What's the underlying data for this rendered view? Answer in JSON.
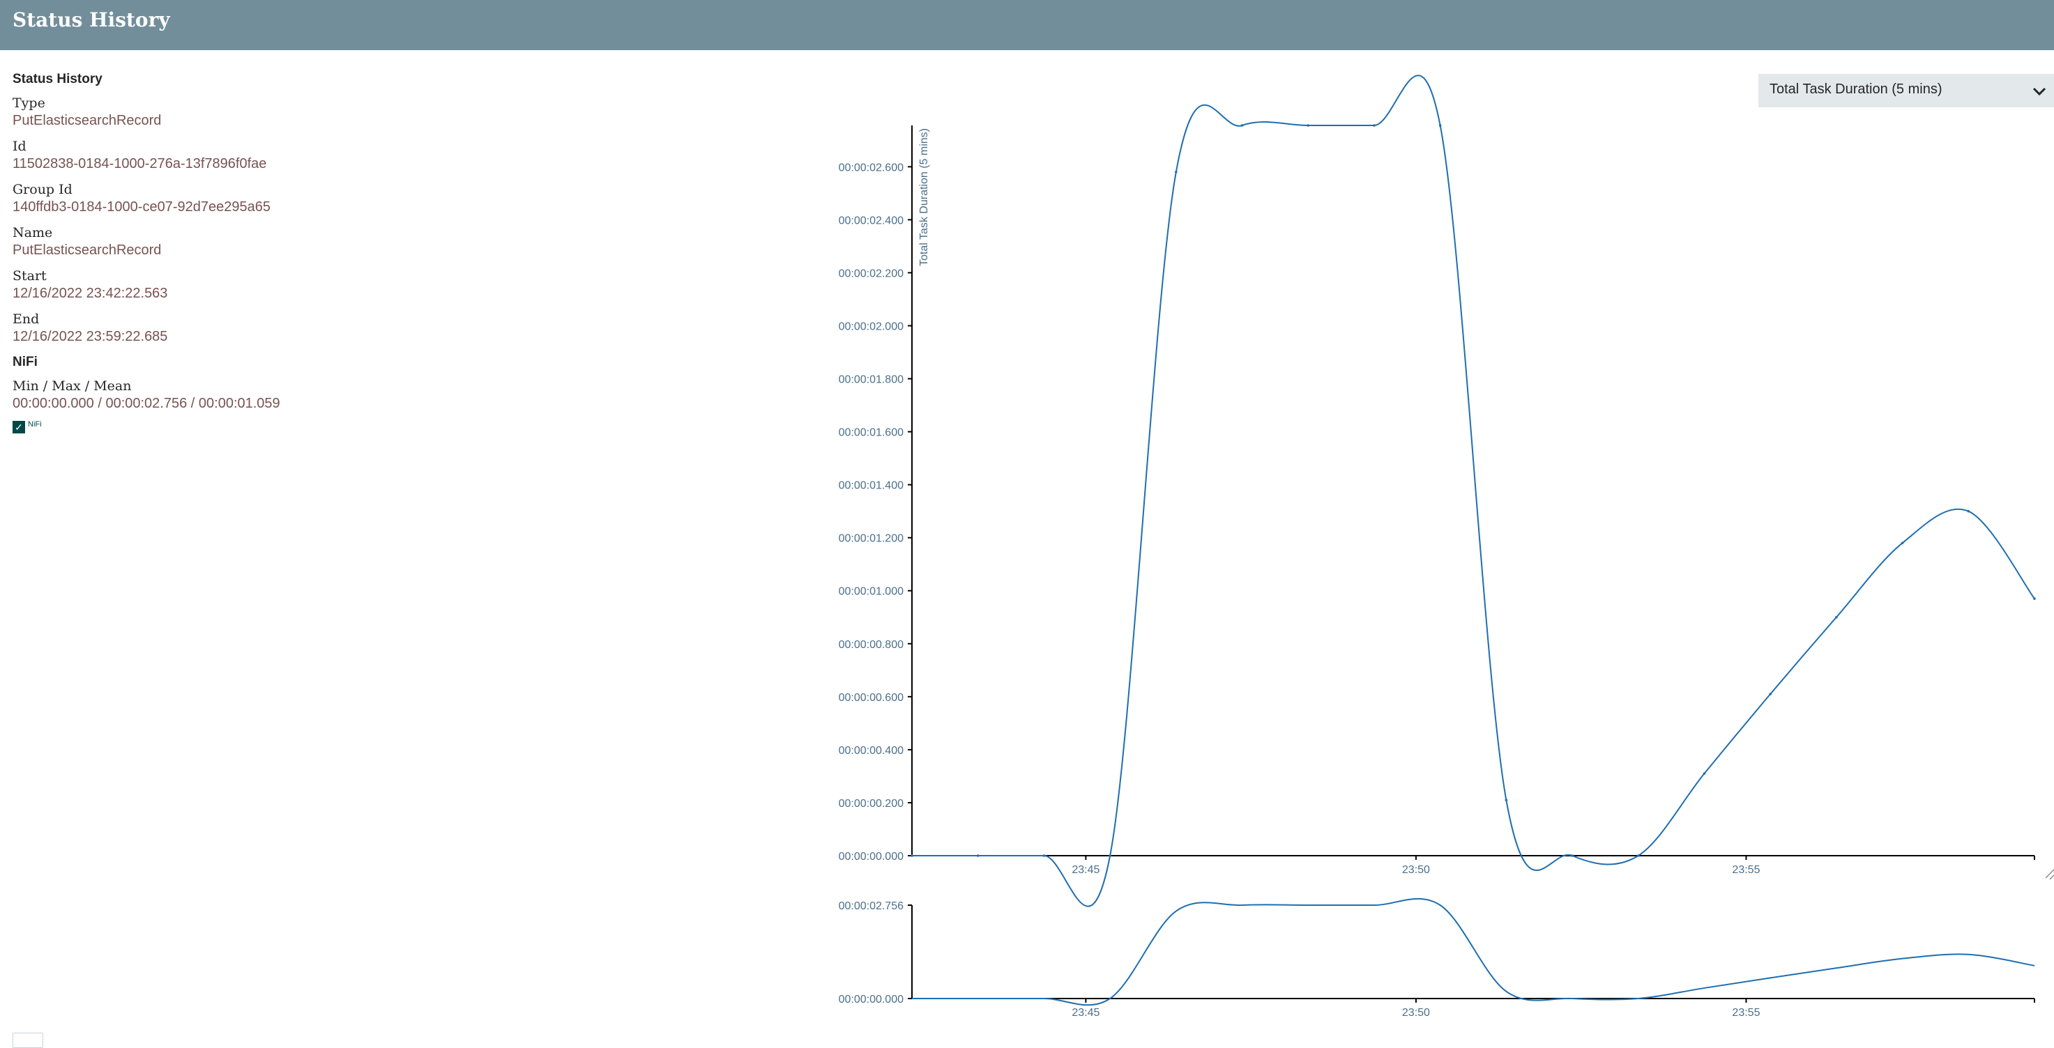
{
  "header": {
    "title": "Status History"
  },
  "info": {
    "section_title": "Status History",
    "fields": [
      {
        "label": "Type",
        "value": "PutElasticsearchRecord"
      },
      {
        "label": "Id",
        "value": "11502838-0184-1000-276a-13f7896f0fae"
      },
      {
        "label": "Group Id",
        "value": "140ffdb3-0184-1000-ce07-92d7ee295a65"
      },
      {
        "label": "Name",
        "value": "PutElasticsearchRecord"
      },
      {
        "label": "Start",
        "value": "12/16/2022 23:42:22.563"
      },
      {
        "label": "End",
        "value": "12/16/2022 23:59:22.685"
      }
    ],
    "cluster_title": "NiFi",
    "stats_label": "Min / Max / Mean",
    "stats_value": "00:00:00.000 / 00:00:02.756 / 00:00:01.059",
    "legend_label": "NiFi",
    "legend_checked": true
  },
  "metric_select": {
    "selected": "Total Task Duration (5 mins)"
  },
  "colors": {
    "header": "#728e9b",
    "line": "#1f6eb0",
    "axis_text": "#4a6f8c",
    "value_text": "#775351"
  },
  "chart_data": [
    {
      "type": "line",
      "title": "",
      "ylabel": "Total Task Duration (5 mins)",
      "x": [
        "23:42:22",
        "23:43:22",
        "23:44:22",
        "23:45:22",
        "23:46:22",
        "23:47:22",
        "23:48:22",
        "23:49:22",
        "23:50:22",
        "23:51:22",
        "23:52:22",
        "23:53:22",
        "23:54:22",
        "23:55:22",
        "23:56:22",
        "23:57:22",
        "23:58:22",
        "23:59:22"
      ],
      "series": [
        {
          "values": [
            0,
            0,
            0,
            0,
            2.58,
            2.756,
            2.756,
            2.756,
            2.756,
            0.21,
            0,
            0,
            0.31,
            0.61,
            0.9,
            1.18,
            1.3,
            0.97
          ]
        }
      ],
      "xlim": [
        "23:42:22",
        "23:59:22"
      ],
      "ylim": [
        0,
        2.756
      ],
      "xticks": [
        "23:45",
        "23:50",
        "23:55"
      ],
      "yticks": [
        "00:00:00.000",
        "00:00:00.200",
        "00:00:00.400",
        "00:00:00.600",
        "00:00:00.800",
        "00:00:01.000",
        "00:00:01.200",
        "00:00:01.400",
        "00:00:01.600",
        "00:00:01.800",
        "00:00:02.000",
        "00:00:02.200",
        "00:00:02.400",
        "00:00:02.600"
      ],
      "grid": false
    },
    {
      "type": "line",
      "role": "overview",
      "x": [
        "23:42:22",
        "23:43:22",
        "23:44:22",
        "23:45:22",
        "23:46:22",
        "23:47:22",
        "23:48:22",
        "23:49:22",
        "23:50:22",
        "23:51:22",
        "23:52:22",
        "23:53:22",
        "23:54:22",
        "23:55:22",
        "23:56:22",
        "23:57:22",
        "23:58:22",
        "23:59:22"
      ],
      "series": [
        {
          "values": [
            0,
            0,
            0,
            0,
            2.58,
            2.756,
            2.756,
            2.756,
            2.756,
            0.21,
            0,
            0,
            0.31,
            0.61,
            0.9,
            1.18,
            1.3,
            0.97
          ]
        }
      ],
      "ylim": [
        0,
        2.756
      ],
      "xticks": [
        "23:45",
        "23:50",
        "23:55"
      ],
      "yticks": [
        "00:00:00.000",
        "00:00:02.756"
      ]
    }
  ]
}
